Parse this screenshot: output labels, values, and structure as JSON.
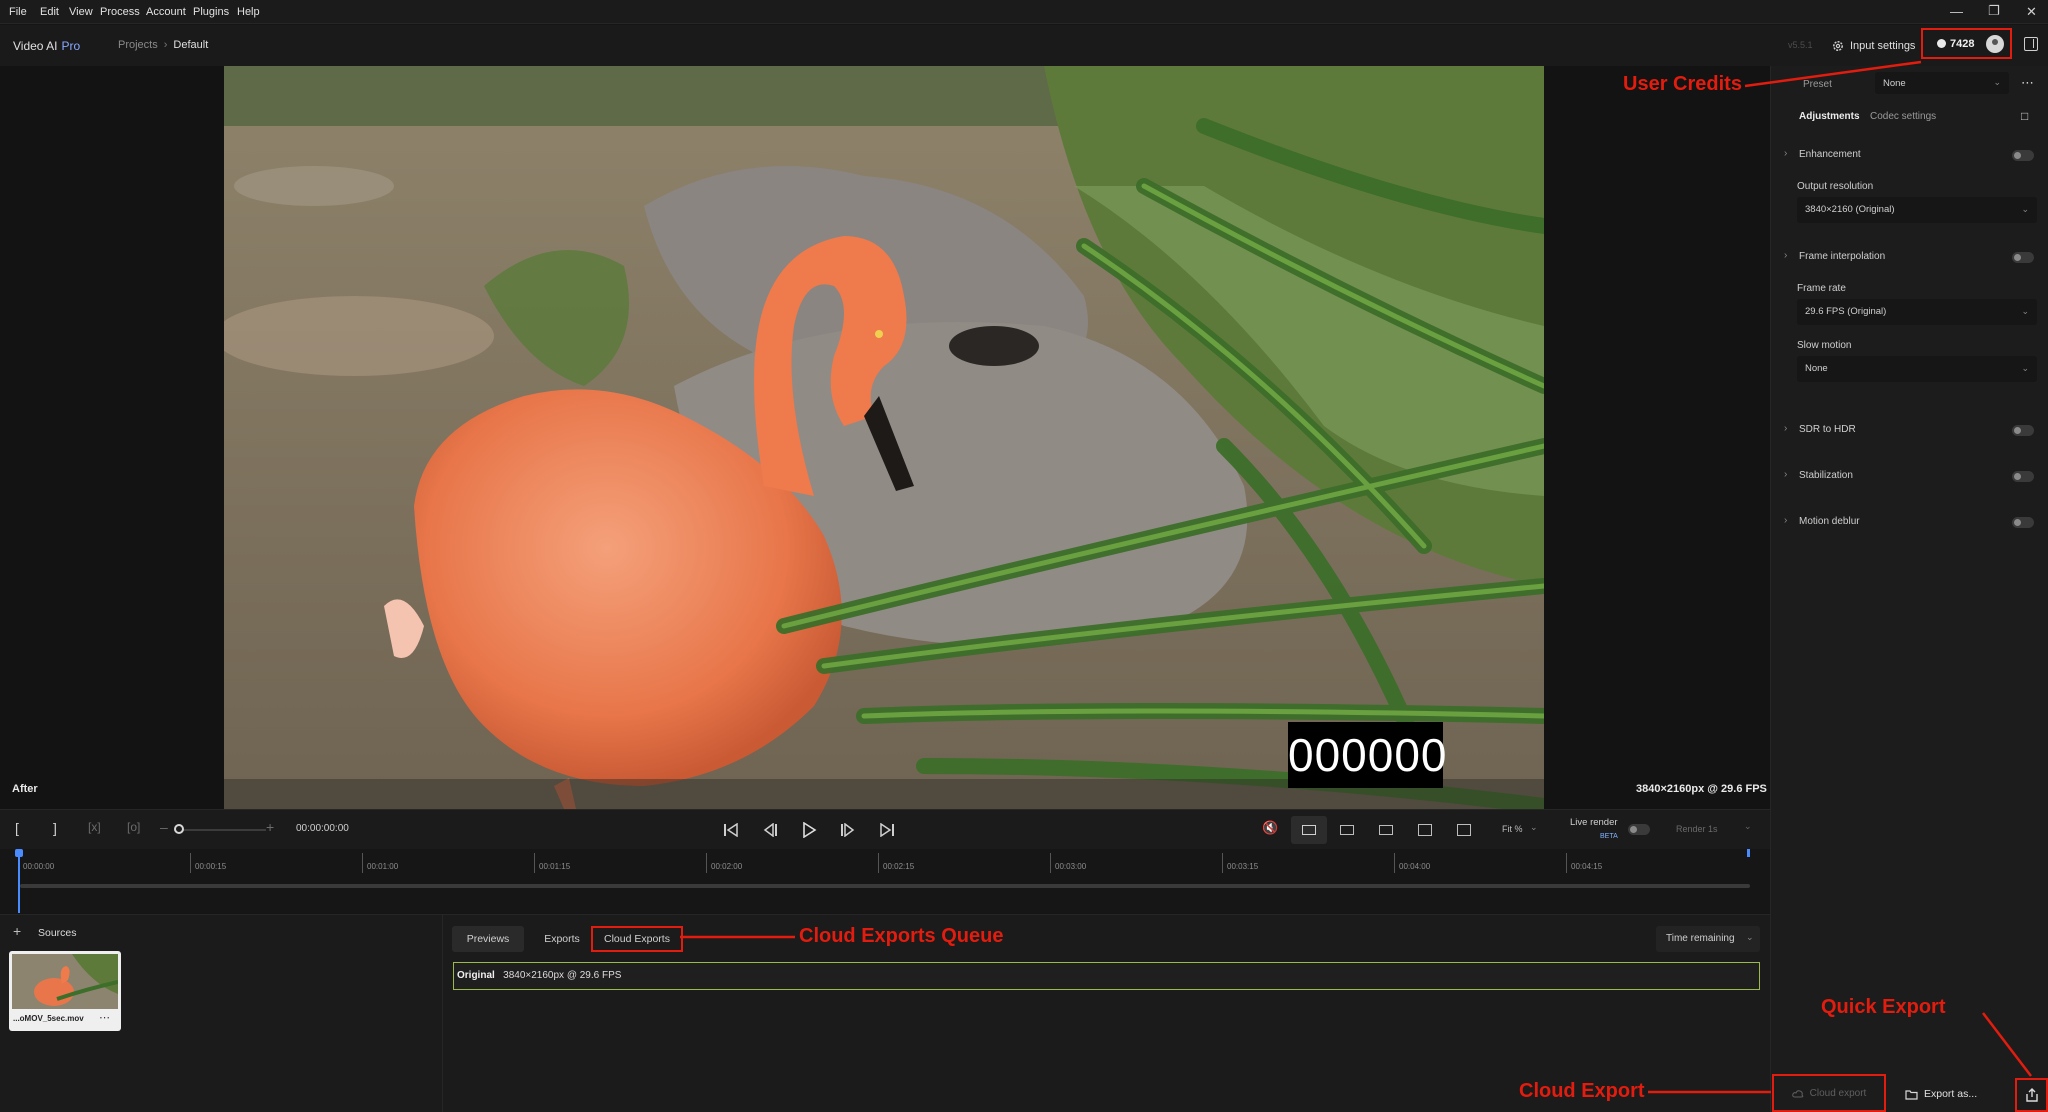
{
  "menubar": {
    "items": [
      "File",
      "Edit",
      "View",
      "Process",
      "Account",
      "Plugins",
      "Help"
    ],
    "window_controls": [
      "minimize-icon",
      "restore-icon",
      "close-icon"
    ]
  },
  "header": {
    "app_name": "Video AI",
    "app_tier": "Pro",
    "breadcrumb": {
      "parent": "Projects",
      "current": "Default"
    },
    "version": "v5.5.1",
    "input_settings_label": "Input settings",
    "credits": "7428"
  },
  "viewer": {
    "frame_counter": "000000",
    "mode_label": "After",
    "resolution_label": "3840×2160px @ 29.6 FPS"
  },
  "right_panel": {
    "preset_label": "Preset",
    "preset_value": "None",
    "tabs": [
      "Adjustments",
      "Codec settings"
    ],
    "enhancement_label": "Enhancement",
    "output_resolution_label": "Output resolution",
    "output_resolution_value": "3840×2160 (Original)",
    "frame_interpolation_label": "Frame interpolation",
    "frame_rate_label": "Frame rate",
    "frame_rate_value": "29.6 FPS (Original)",
    "slow_motion_label": "Slow motion",
    "slow_motion_value": "None",
    "sdr_hdr_label": "SDR to HDR",
    "stabilization_label": "Stabilization",
    "motion_deblur_label": "Motion deblur",
    "cloud_export_label": "Cloud export",
    "export_as_label": "Export as..."
  },
  "controls": {
    "timecode": "00:00:00:00",
    "fit_label": "Fit %",
    "live_render_label": "Live render",
    "beta_label": "BETA",
    "render_label": "Render 1s"
  },
  "timeline": {
    "ticks": [
      "00:00:00",
      "00:00:15",
      "00:01:00",
      "00:01:15",
      "00:02:00",
      "00:02:15",
      "00:03:00",
      "00:03:15",
      "00:04:00",
      "00:04:15"
    ]
  },
  "sources": {
    "title": "Sources",
    "file_name": "...oMOV_5sec.mov"
  },
  "exports": {
    "tabs": [
      "Previews",
      "Exports",
      "Cloud Exports"
    ],
    "time_remaining_label": "Time remaining",
    "queue_item": {
      "name": "Original",
      "details": "3840×2160px @ 29.6 FPS"
    }
  },
  "annotations": {
    "user_credits": "User Credits",
    "cloud_exports_queue": "Cloud Exports Queue",
    "quick_export": "Quick Export",
    "cloud_export": "Cloud Export"
  },
  "colors": {
    "annotation": "#e21c0e",
    "accent": "#4a8cff",
    "queue_border": "#9cba47"
  }
}
